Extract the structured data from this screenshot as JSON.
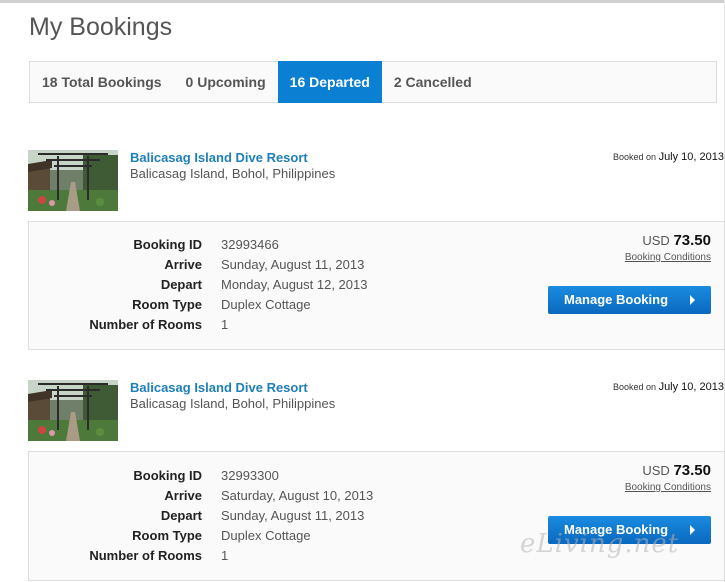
{
  "page": {
    "title": "My Bookings"
  },
  "tabs": [
    {
      "label": "18 Total Bookings",
      "active": false
    },
    {
      "label": "0 Upcoming",
      "active": false
    },
    {
      "label": "16 Departed",
      "active": true
    },
    {
      "label": "2 Cancelled",
      "active": false
    }
  ],
  "labels": {
    "booking_id": "Booking ID",
    "arrive": "Arrive",
    "depart": "Depart",
    "room_type": "Room Type",
    "num_rooms": "Number of Rooms",
    "booked_on": "Booked on",
    "currency": "USD",
    "conditions": "Booking Conditions",
    "manage": "Manage Booking"
  },
  "bookings": [
    {
      "hotel_name": "Balicasag Island Dive Resort",
      "location": "Balicasag Island, Bohol, Philippines",
      "booked_date": "July 10, 2013",
      "booking_id": "32993466",
      "arrive": "Sunday, August 11, 2013",
      "depart": "Monday, August 12, 2013",
      "room_type": "Duplex Cottage",
      "num_rooms": "1",
      "price": "73.50"
    },
    {
      "hotel_name": "Balicasag Island Dive Resort",
      "location": "Balicasag Island, Bohol, Philippines",
      "booked_date": "July 10, 2013",
      "booking_id": "32993300",
      "arrive": "Saturday, August 10, 2013",
      "depart": "Sunday, August 11, 2013",
      "room_type": "Duplex Cottage",
      "num_rooms": "1",
      "price": "73.50"
    }
  ],
  "watermark": "eLiving.net",
  "colors": {
    "accent": "#0b7fd2",
    "link": "#1f7fb8"
  }
}
